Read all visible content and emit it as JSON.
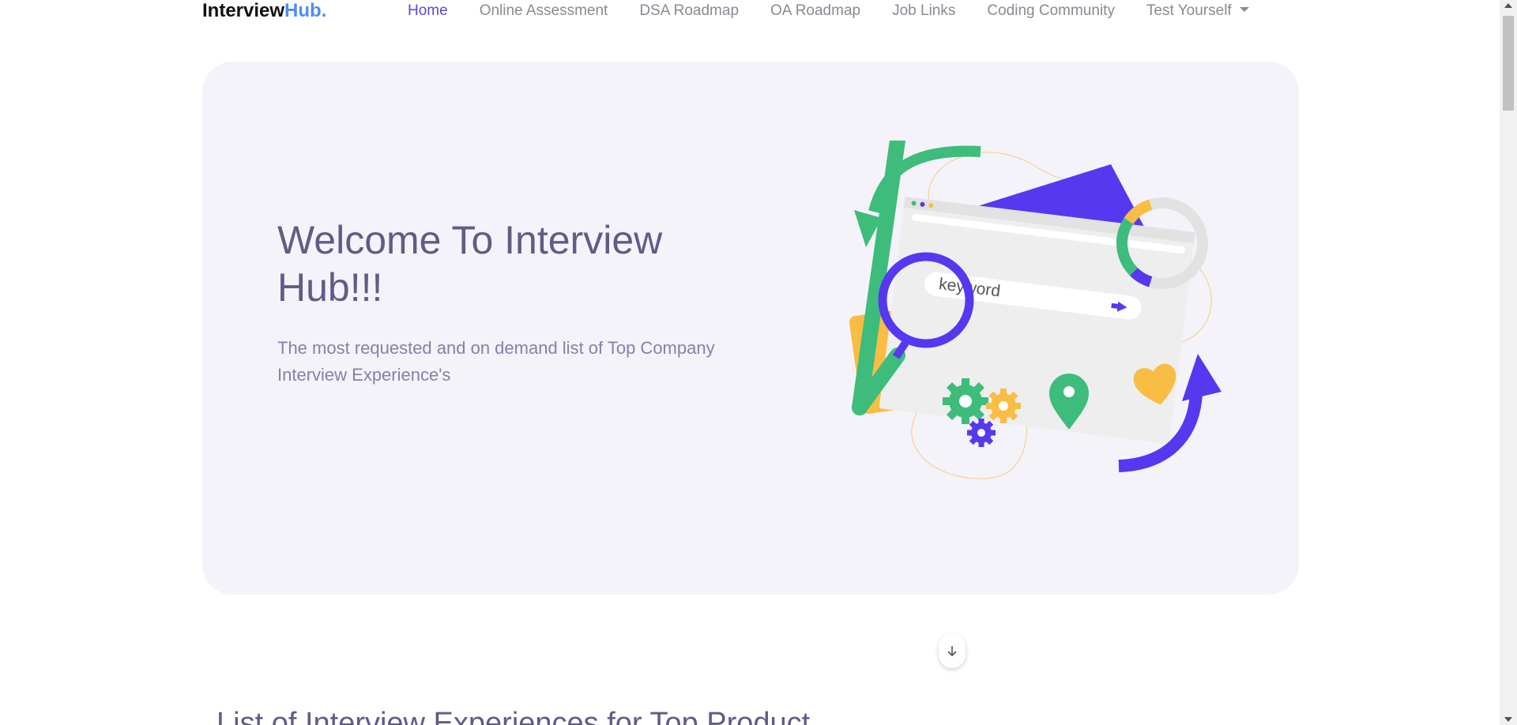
{
  "brand": {
    "main": "Interview",
    "accent": "Hub."
  },
  "nav": {
    "items": [
      {
        "label": "Home",
        "active": true
      },
      {
        "label": "Online Assessment"
      },
      {
        "label": "DSA Roadmap"
      },
      {
        "label": "OA Roadmap"
      },
      {
        "label": "Job Links"
      },
      {
        "label": "Coding Community"
      },
      {
        "label": "Test Yourself",
        "dropdown": true
      }
    ]
  },
  "hero": {
    "title": "Welcome To Interview Hub!!!",
    "subtitle": "The most requested and on demand list of Top Company Interview Experience's",
    "illustration": {
      "search_text": "keyword"
    },
    "scroll_icon": "arrow-down-icon"
  },
  "section": {
    "title": "List of Interview Experiences for Top Product"
  },
  "colors": {
    "accent": "#5a4bd1",
    "brand_accent": "#4e8cf7",
    "hero_bg": "#f4f3fa",
    "heading": "#615b86",
    "green": "#3ebc7b",
    "yellow": "#f9bd44",
    "purple": "#5638f0"
  }
}
